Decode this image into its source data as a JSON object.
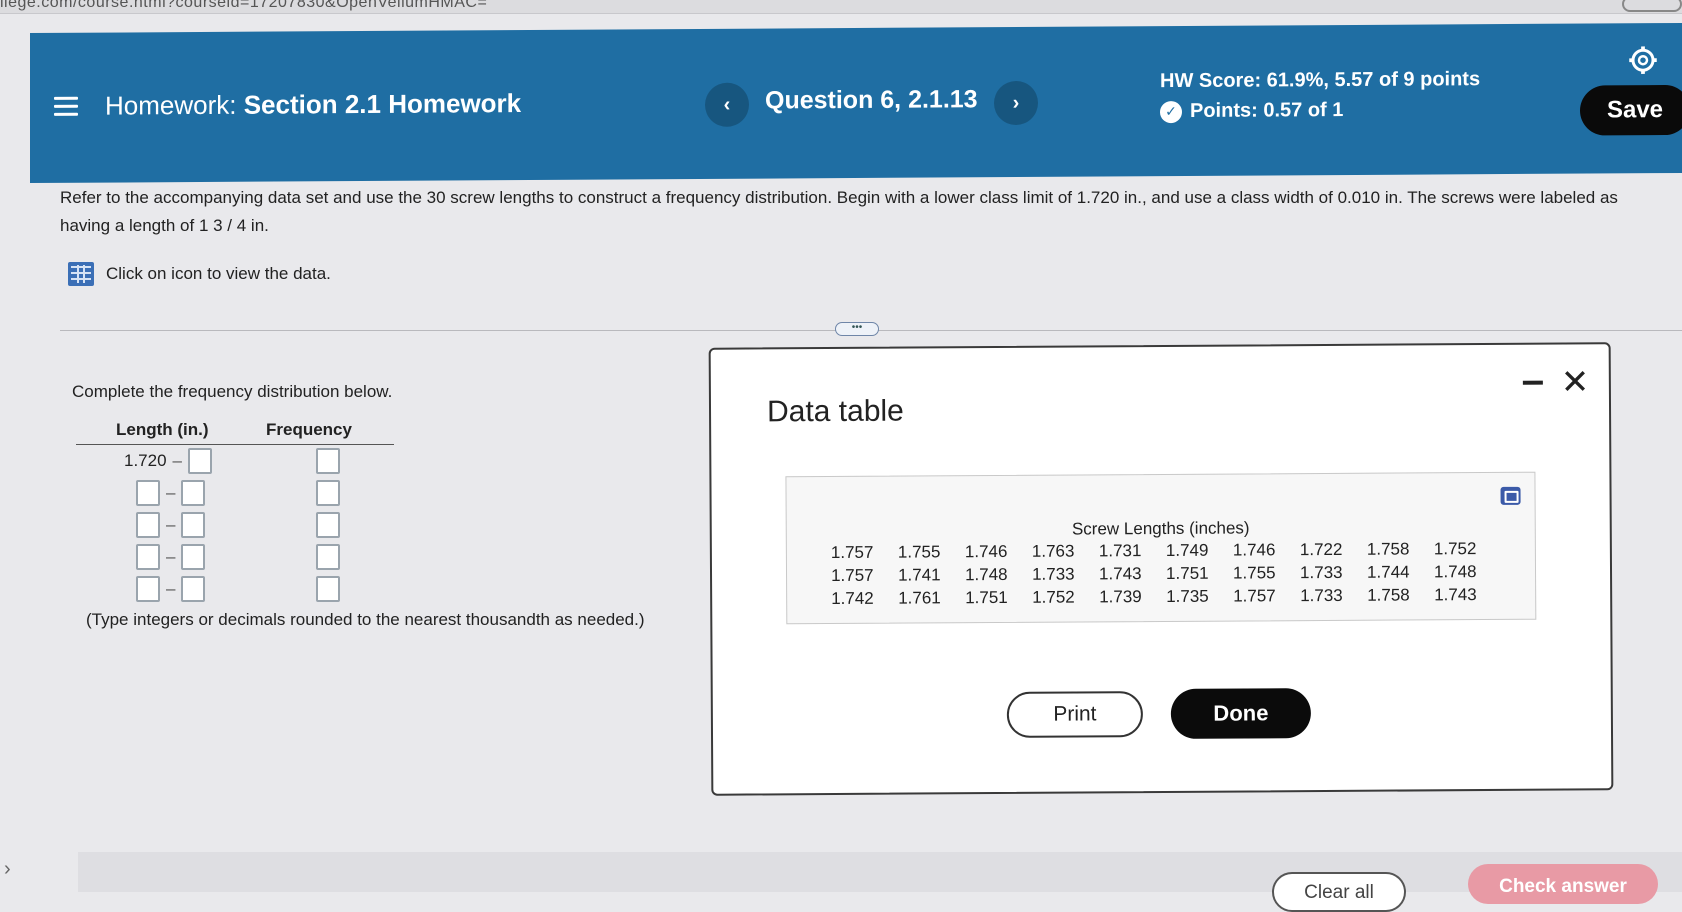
{
  "browser": {
    "url_fragment": "llege.com/course.html?courseid=17207830&OpenVellumHMAC="
  },
  "header": {
    "title_prefix": "Homework:",
    "title_main": "Section 2.1 Homework",
    "question": "Question 6, 2.1.13",
    "hw_score": "HW Score: 61.9%, 5.57 of 9 points",
    "points": "Points: 0.57 of 1",
    "save_label": "Save",
    "prev_icon": "chevron-left",
    "next_icon": "chevron-right"
  },
  "prompt": {
    "text": "Refer to the accompanying data set and use the 30 screw lengths to construct a frequency distribution. Begin with a lower class limit of 1.720 in., and use a class width of 0.010 in. The screws were labeled as having a length of 1 3 / 4 in.",
    "data_link": "Click on icon to view the data."
  },
  "distribution": {
    "instruction": "Complete the frequency distribution below.",
    "col_length": "Length (in.)",
    "col_frequency": "Frequency",
    "first_lower": "1.720",
    "hint": "(Type integers or decimals rounded to the nearest thousandth as needed.)"
  },
  "modal": {
    "title": "Data table",
    "heading": "Screw Lengths (inches)",
    "values": [
      "1.757",
      "1.755",
      "1.746",
      "1.763",
      "1.731",
      "1.749",
      "1.746",
      "1.722",
      "1.758",
      "1.752",
      "1.757",
      "1.741",
      "1.748",
      "1.733",
      "1.743",
      "1.751",
      "1.755",
      "1.733",
      "1.744",
      "1.748",
      "1.742",
      "1.761",
      "1.751",
      "1.752",
      "1.739",
      "1.735",
      "1.757",
      "1.733",
      "1.758",
      "1.743"
    ],
    "print_label": "Print",
    "done_label": "Done"
  },
  "footer": {
    "clear_label": "Clear all",
    "check_label": "Check answer"
  },
  "colors": {
    "header_bg": "#1f6ea3",
    "save_bg": "#0a0a0a",
    "check_bg": "#e89aa5"
  }
}
